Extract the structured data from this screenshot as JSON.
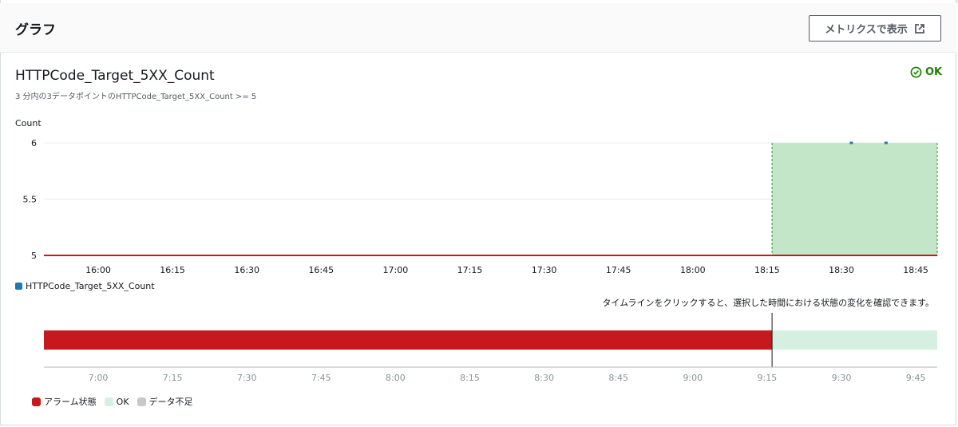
{
  "header": {
    "title": "グラフ",
    "metrics_button_label": "メトリクスで表示"
  },
  "alarm": {
    "name": "HTTPCode_Target_5XX_Count",
    "condition": "3 分内の3データポイントのHTTPCode_Target_5XX_Count >= 5",
    "state": "OK"
  },
  "colors": {
    "alarm": "#c7191d",
    "ok_fill": "#c3e6c8",
    "ok_light": "#d5f0e0",
    "series": "#1f77b4",
    "insufficient": "#c8c8c8"
  },
  "chart_data": [
    {
      "type": "line",
      "ylabel": "Count",
      "ylim": [
        5,
        6
      ],
      "yticks": [
        "6",
        "5.5",
        "5"
      ],
      "xticks": [
        "16:00",
        "16:15",
        "16:30",
        "16:45",
        "17:00",
        "17:15",
        "17:30",
        "17:45",
        "18:00",
        "18:15",
        "18:30",
        "18:45"
      ],
      "threshold": 5,
      "series": [
        {
          "name": "HTTPCode_Target_5XX_Count",
          "points": [
            {
              "x": "18:32",
              "y": 6
            },
            {
              "x": "18:39",
              "y": 6
            }
          ]
        }
      ],
      "alarm_region": {
        "from": "18:16",
        "to": "18:50",
        "state": "OK"
      },
      "legend": [
        "HTTPCode_Target_5XX_Count"
      ]
    },
    {
      "type": "timeline",
      "hint": "タイムラインをクリックすると、選択した時間における状態の変化を確認できます。",
      "xticks": [
        "7:00",
        "7:15",
        "7:30",
        "7:45",
        "8:00",
        "8:15",
        "8:30",
        "8:45",
        "9:00",
        "9:15",
        "9:30",
        "9:45"
      ],
      "segments": [
        {
          "from": "6:49",
          "to": "9:16",
          "state": "アラーム状態"
        },
        {
          "from": "9:16",
          "to": "9:50",
          "state": "OK"
        }
      ],
      "legend": [
        "アラーム状態",
        "OK",
        "データ不足"
      ]
    }
  ]
}
